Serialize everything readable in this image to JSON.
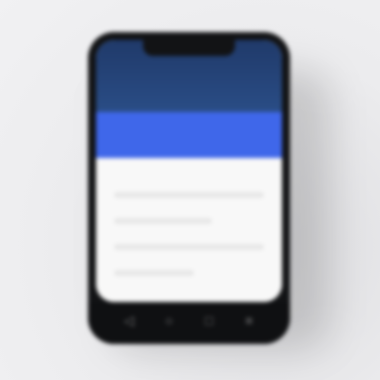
{
  "colors": {
    "background": "#ececee",
    "phone_body": "#121315",
    "status_header": "#2a4d86",
    "app_bar": "#3f67ea",
    "content_background": "#f8f8f8",
    "nav_bar": "#0f1012"
  },
  "phone": {
    "navigation": [
      {
        "icon": "back-icon",
        "glyph": "◁"
      },
      {
        "icon": "home-icon",
        "glyph": "○"
      },
      {
        "icon": "recent-apps-icon",
        "glyph": "□"
      },
      {
        "icon": "menu-icon",
        "glyph": "≡"
      }
    ]
  }
}
